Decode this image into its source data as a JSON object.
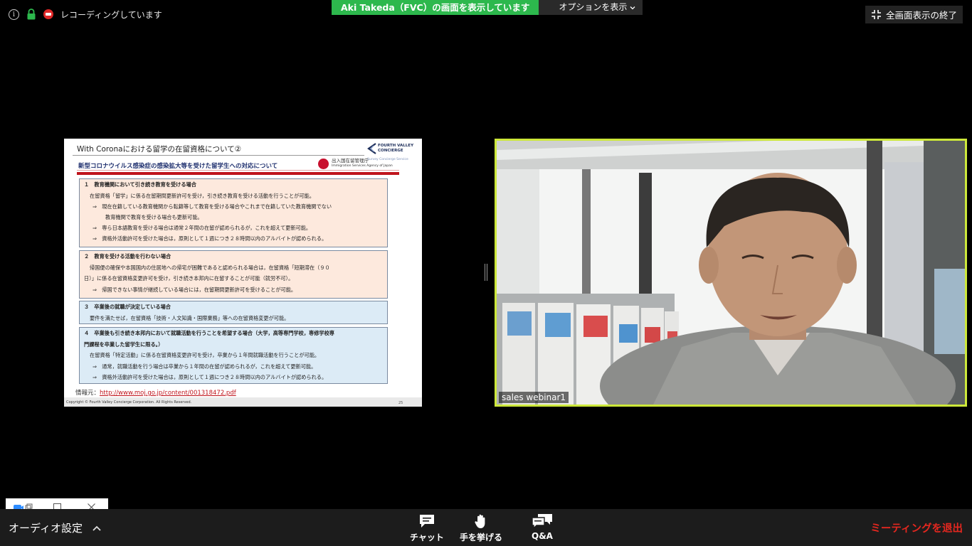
{
  "top_bar": {
    "recording_text": "レコーディングしています",
    "share_banner": "Aki Takeda（FVC）の画面を表示しています",
    "options_label": "オプションを表示",
    "exit_fullscreen_label": "全画面表示の終了"
  },
  "slide": {
    "title": "With Coronaにおける留学の在留資格について②",
    "brand_line1": "FOURTH VALLEY",
    "brand_line2": "CONCIERGE",
    "brand_sub": "Survey Concierge Service",
    "subtitle": "新型コロナウイルス感染症の感染拡大等を受けた留学生への対応について",
    "agency_jp": "出入国在留管理庁",
    "agency_en": "Immigration Services Agency of Japan",
    "box1": {
      "heading": "１　教育機関において引き続き教育を受ける場合",
      "line1": "在留資格「留学」に係る在留期間更新許可を受け，引き続き教育を受ける活動を行うことが可能。",
      "line2": "⇒　現在在籍している教育機関から転籍等して教育を受ける場合やこれまで在籍していた教育機関でない",
      "line3": "教育機関で教育を受ける場合も更新可能。",
      "line4": "⇒　専ら日本語教育を受ける場合は通常２年間の在留が認められるが，これを超えて更新可能。",
      "line5": "⇒　資格外活動許可を受けた場合は，原則として１週につき２８時間以内のアルバイトが認められる。"
    },
    "box2": {
      "heading": "２　教育を受ける活動を行わない場合",
      "line1": "帰国便の確保や本国国内の住居地への帰宅が困難であると認められる場合は，在留資格「短期滞在（９０",
      "line2": "日）」に係る在留資格変更許可を受け，引き続き本邦内に在留することが可能（就労不可）。",
      "line3": "⇒　帰国できない事情が継続している場合には，在留期間更新許可を受けることが可能。"
    },
    "box3": {
      "heading": "３　卒業後の就職が決定している場合",
      "line1": "要件を満たせば，在留資格「技術・人文知識・国際業務」等への在留資格変更が可能。"
    },
    "box4": {
      "heading": "４　卒業後も引き続き本邦内において就職活動を行うことを希望する場合（大学，高等専門学校，専修学校専",
      "heading2": "門課程を卒業した留学生に限る。）",
      "line1": "在留資格「特定活動」に係る在留資格変更許可を受け，卒業から１年間就職活動を行うことが可能。",
      "line2": "⇒　通常，就職活動を行う場合は卒業から１年間の在留が認められるが，これを超えて更新可能。",
      "line3": "⇒　資格外活動許可を受けた場合は，原則として１週につき２８時間以内のアルバイトが認められる。"
    },
    "source_label": "情報元：",
    "source_url": "http://www.moj.go.jp/content/001318472.pdf",
    "copyright": "Copyright © Fourth Valley Concierge Corporation. All Rights Reserved.",
    "page_number": "25"
  },
  "video": {
    "participant_name": "sales webinar1"
  },
  "bottom_bar": {
    "audio_settings": "オーディオ設定",
    "chat": "チャット",
    "raise_hand": "手を挙げる",
    "qa": "Q&A",
    "leave": "ミーティングを退出"
  },
  "colors": {
    "share_green": "#2db84d",
    "active_speaker_border": "#cde83a",
    "leave_red": "#e5271f"
  }
}
